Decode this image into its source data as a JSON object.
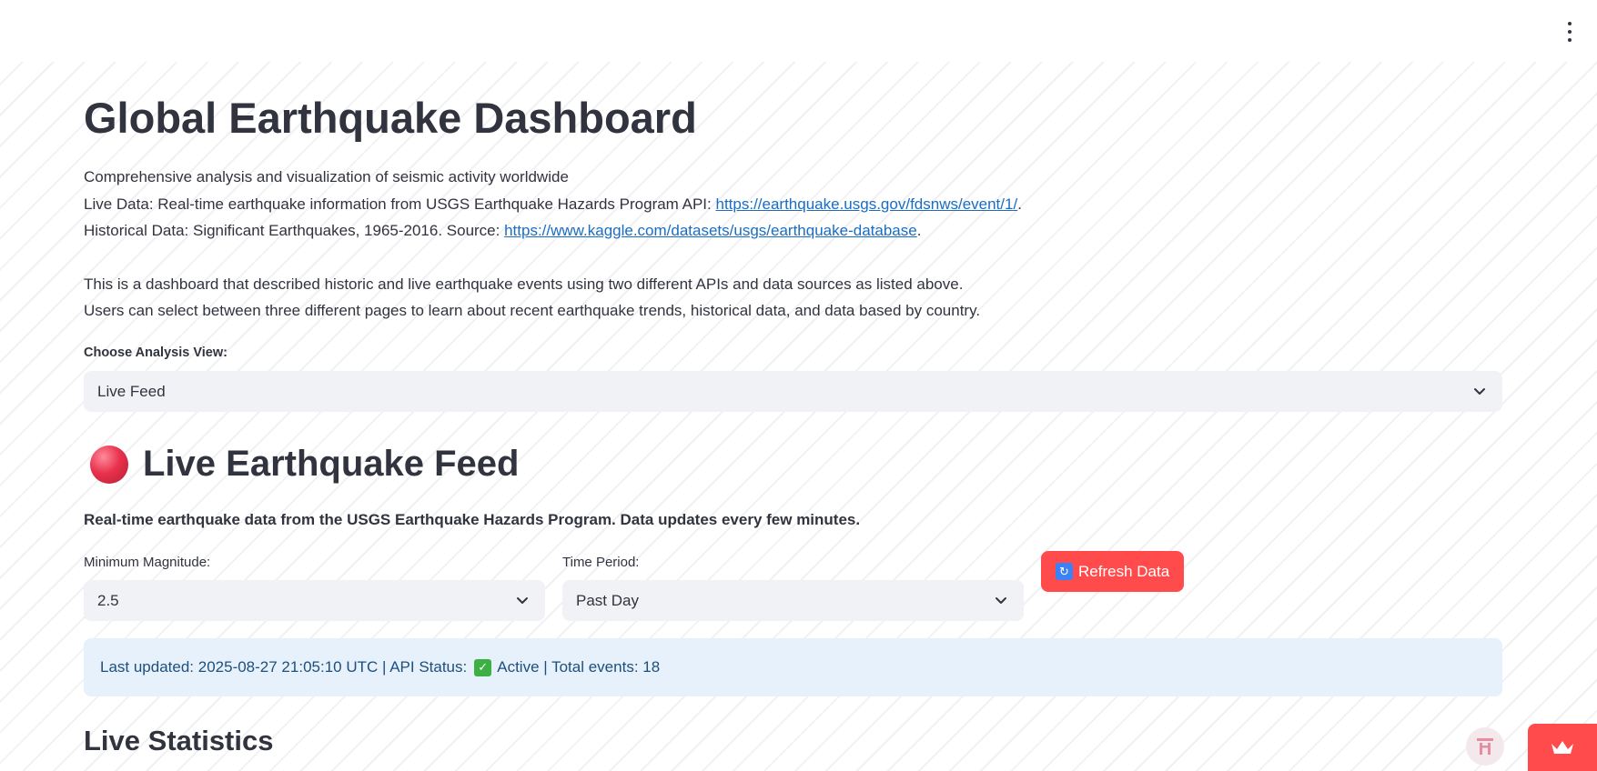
{
  "header": {
    "menu_icon": "kebab-menu-icon"
  },
  "main": {
    "title": "Global Earthquake Dashboard",
    "intro": {
      "line1": "Comprehensive analysis and visualization of seismic activity worldwide",
      "live_prefix": "Live Data: Real-time earthquake information from USGS Earthquake Hazards Program API: ",
      "live_link": "https://earthquake.usgs.gov/fdsnws/event/1/",
      "historical_prefix": "Historical Data: Significant Earthquakes, 1965-2016. Source: ",
      "historical_link": "https://www.kaggle.com/datasets/usgs/earthquake-database",
      "period": ".",
      "desc1": "This is a dashboard that described historic and live earthquake events using two different APIs and data sources as listed above.",
      "desc2": "Users can select between three different pages to learn about recent earthquake trends, historical data, and data based by country."
    },
    "analysis_view": {
      "label": "Choose Analysis View:",
      "value": "Live Feed"
    },
    "live_feed": {
      "icon": "red-circle-icon",
      "title": "Live Earthquake Feed",
      "subtitle": "Real-time earthquake data from the USGS Earthquake Hazards Program. Data updates every few minutes.",
      "min_magnitude": {
        "label": "Minimum Magnitude:",
        "value": "2.5"
      },
      "time_period": {
        "label": "Time Period:",
        "value": "Past Day"
      },
      "refresh_button": {
        "icon": "refresh-icon",
        "label": "Refresh Data"
      },
      "status": {
        "prefix": "Last updated: 2025-08-27 21:05:10 UTC | API Status:",
        "icon": "check-icon",
        "suffix": "Active | Total events: 18"
      },
      "stats_title": "Live Statistics"
    }
  },
  "colors": {
    "accent": "#ff4b4b",
    "link": "#1a6dc2",
    "info_bg": "#e6f1fb",
    "text": "#31333f"
  }
}
